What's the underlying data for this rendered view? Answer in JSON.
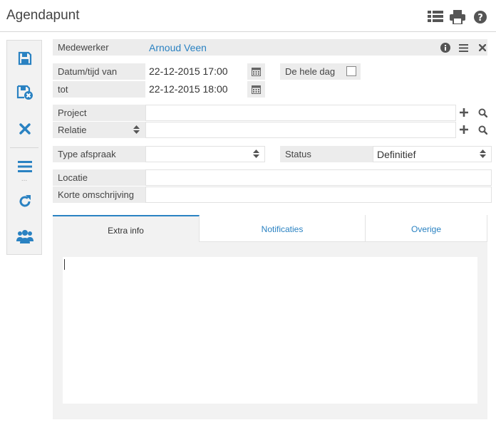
{
  "header": {
    "title": "Agendapunt"
  },
  "icons": {
    "list": "list-icon",
    "print": "print-icon",
    "help": "help-icon",
    "save": "save-icon",
    "save_close": "save-close-icon",
    "delete": "delete-icon",
    "menu": "menu-icon",
    "refresh": "refresh-icon",
    "users": "users-icon"
  },
  "colors": {
    "accent": "#2a82c2",
    "label_bg": "#ececec",
    "panel_bg": "#f2f2f2"
  },
  "toolbar": {
    "dots": "..."
  },
  "form": {
    "medewerker_label": "Medewerker",
    "medewerker_value": "Arnoud Veen",
    "datum_van_label": "Datum/tijd van",
    "datum_van_value": "22-12-2015 17:00",
    "tot_label": "tot",
    "tot_value": "22-12-2015 18:00",
    "hele_dag_label": "De hele dag",
    "hele_dag_checked": false,
    "project_label": "Project",
    "project_value": "",
    "relatie_label": "Relatie",
    "relatie_value": "",
    "type_label": "Type afspraak",
    "type_value": "",
    "status_label": "Status",
    "status_value": "Definitief",
    "locatie_label": "Locatie",
    "locatie_value": "",
    "omschrijving_label": "Korte omschrijving",
    "omschrijving_value": ""
  },
  "tabs": [
    {
      "label": "Extra info",
      "active": true
    },
    {
      "label": "Notificaties",
      "active": false
    },
    {
      "label": "Overige",
      "active": false
    }
  ],
  "extra_info_text": ""
}
